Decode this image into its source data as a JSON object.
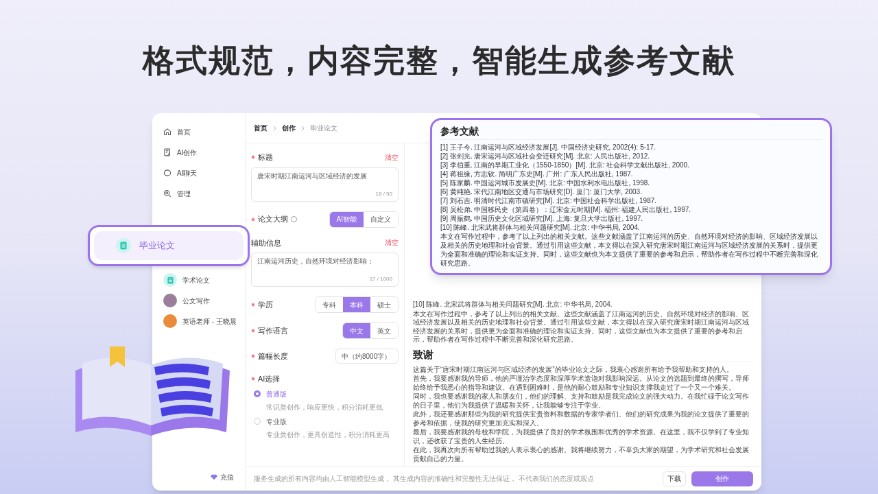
{
  "headline": "格式规范，内容完整，智能生成参考文献",
  "sidebar": {
    "items": [
      {
        "label": "首页"
      },
      {
        "label": "AI创作"
      },
      {
        "label": "AI聊天"
      },
      {
        "label": "管理"
      }
    ],
    "apps": [
      {
        "label": "学术论文",
        "kind": "icon"
      },
      {
        "label": "公文写作",
        "kind": "avatar",
        "color": "#9b7f9a"
      },
      {
        "label": "英语老师 - 王晓晨",
        "kind": "avatar",
        "color": "#e98b3a"
      }
    ],
    "recharge": "充值"
  },
  "highlight": {
    "label": "毕业论文"
  },
  "breadcrumb": [
    {
      "label": "首页",
      "current": false
    },
    {
      "label": "创作",
      "current": false
    },
    {
      "label": "毕业论文",
      "current": true
    }
  ],
  "form": [
    {
      "kind": "textarea",
      "label": "标题",
      "required": true,
      "clear": "清空",
      "value": "唐宋时期江南运河与区域经济的发展",
      "counter": "16 / 50"
    },
    {
      "kind": "segmented",
      "label": "论文大纲",
      "required": true,
      "hint_icon": true,
      "options": [
        {
          "label": "AI智能",
          "selected": true
        },
        {
          "label": "自定义",
          "selected": false
        }
      ]
    },
    {
      "kind": "textarea",
      "label": "辅助信息",
      "required": false,
      "clear": "清空",
      "value": "江南运河历史，自然环境对经济影响；",
      "counter": "17 / 1000"
    },
    {
      "kind": "segmented",
      "label": "学历",
      "required": true,
      "options": [
        {
          "label": "专科",
          "selected": false
        },
        {
          "label": "本科",
          "selected": true
        },
        {
          "label": "硕士",
          "selected": false
        }
      ]
    },
    {
      "kind": "segmented",
      "label": "写作语言",
      "required": true,
      "options": [
        {
          "label": "中文",
          "selected": true
        },
        {
          "label": "英文",
          "selected": false
        }
      ]
    },
    {
      "kind": "select",
      "label": "篇幅长度",
      "required": true,
      "value": "中（约8000字）"
    },
    {
      "kind": "radio",
      "label": "AI选择",
      "required": true,
      "options": [
        {
          "label": "普通版",
          "description": "常识类创作，响应更快，积分消耗更低",
          "selected": true
        },
        {
          "label": "专业版",
          "description": "专业类创作，更具创造性，积分消耗更高",
          "selected": false
        }
      ]
    }
  ],
  "references_popup": {
    "title": "参考文献",
    "references": [
      "[1] 王子今. 江南运河与区域经济发展[J]. 中国经济史研究, 2002(4): 5-17.",
      "[2] 张剑光. 唐宋运河与区域社会变迁研究[M]. 北京: 人民出版社, 2012.",
      "[3] 李伯重. 江南的早期工业化（1550-1850）[M]. 北京: 社会科学文献出版社, 2000.",
      "[4] 蒋祖缘, 方志钦. 简明广东史[M]. 广州: 广东人民出版社, 1987.",
      "[5] 陈家麟. 中国运河城市发展史[M]. 北京: 中国水利水电出版社, 1998.",
      "[6] 黄纯艳. 宋代江南地区交通与市场研究[D]. 厦门: 厦门大学, 2003.",
      "[7] 刘石吉. 明清时代江南市镇研究[M]. 北京: 中国社会科学出版社, 1987.",
      "[8] 吴松弟. 中国移民史（第四卷）：辽宋金元时期[M]. 福州: 福建人民出版社, 1997.",
      "[9] 周振鹤. 中国历史文化区域研究[M]. 上海: 复旦大学出版社, 1997.",
      "[10] 陈峰. 北宋武将群体与相关问题研究[M]. 北京: 中华书局, 2004."
    ],
    "summary": "本文在写作过程中，参考了以上列出的相关文献。这些文献涵盖了江南运河的历史、自然环境对经济的影响、区域经济发展以及相关的历史地理和社会背景。通过引用这些文献，本文得以在深入研究唐宋时期江南运河与区域经济发展的关系时，提供更为全面和准确的理论和实证支持。同时，这些文献也为本文提供了重要的参考和启示，帮助作者在写作过程中不断完善和深化研究思路。"
  },
  "document": {
    "reference_line": "[10] 陈峰. 北宋武将群体与相关问题研究[M]. 北京: 中华书局, 2004.",
    "summary": "本文在写作过程中，参考了以上列出的相关文献。这些文献涵盖了江南运河的历史、自然环境对经济的影响、区域经济发展以及相关的历史地理和社会背景。通过引用这些文献，本文得以在深入研究唐宋时期江南运河与区域经济发展的关系时，提供更为全面和准确的理论和实证支持。同时，这些文献也为本文提供了重要的参考和启示，帮助作者在写作过程中不断完善和深化研究思路。",
    "ack_title": "致谢",
    "ack_paragraphs": [
      "这篇关于“唐宋时期江南运河与区域经济的发展”的毕业论文之际，我衷心感谢所有给予我帮助和支持的人。",
      "首先，我要感谢我的导师，他的严谨治学态度和深厚学术造诣对我影响深远。从论文的选题到最终的撰写，导师始终给予我悉心的指导和建议。在遇到困难时，是他的耐心鼓励和专业知识支撑我走过了一个又一个难关。",
      "同时，我也要感谢我的家人和朋友们，他们的理解、支持和鼓励是我完成论文的强大动力。在我忙碌于论文写作的日子里，他们为我提供了温暖和关怀，让我能够专注于学业。",
      "此外，我还要感谢那些为我的研究提供宝贵资料和数据的专家学者们。他们的研究成果为我的论文提供了重要的参考和依据，使我的研究更加充实和深入。",
      "最后，我要感谢我的母校和学院，为我提供了良好的学术氛围和优秀的学术资源。在这里，我不仅学到了专业知识，还收获了宝贵的人生经历。",
      "在此，我再次向所有帮助过我的人表示衷心的感谢。我将继续努力，不辜负大家的期望，为学术研究和社会发展贡献自己的力量。"
    ]
  },
  "footer": {
    "disclaimer": "服务生成的所有内容均由人工智能模型生成， 其生成内容的准确性和完整性无法保证， 不代表我们的态度或观点",
    "buttons": [
      {
        "label": "下载",
        "kind": "secondary"
      },
      {
        "label": "创作",
        "kind": "primary"
      }
    ]
  }
}
